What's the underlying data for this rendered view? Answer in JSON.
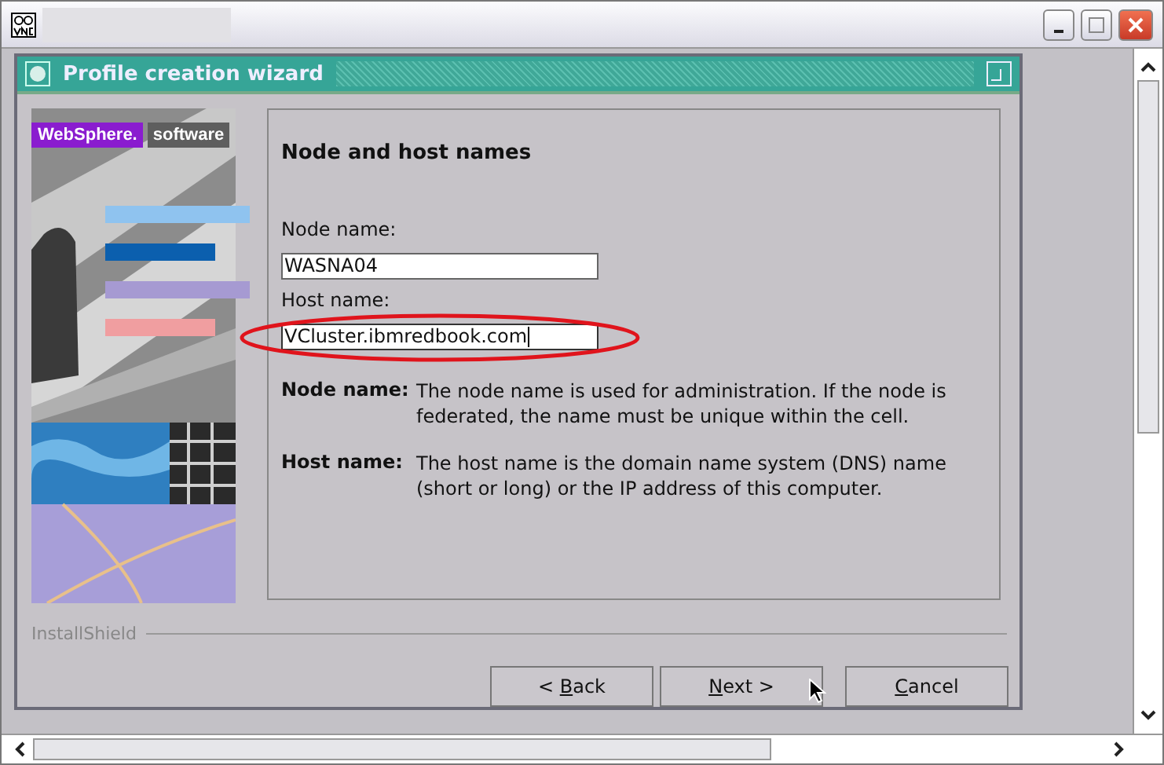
{
  "wizard": {
    "title": "Profile creation wizard",
    "brand": {
      "name": "WebSphere.",
      "product": "software"
    },
    "heading": "Node and host names",
    "fields": [
      {
        "label": "Node name:",
        "value": "WASNA04",
        "focused": false
      },
      {
        "label": "Host name:",
        "value": "VCluster.ibmredbook.com",
        "focused": true,
        "circled": true
      }
    ],
    "help": [
      {
        "term": "Node name:",
        "text": "The node name is used for administration. If the node is federated, the name must be unique within the cell."
      },
      {
        "term": "Host name:",
        "text": "The host name is the domain name system (DNS) name (short or long) or the IP address of this computer."
      }
    ],
    "footer_label": "InstallShield",
    "buttons": [
      {
        "before": "< ",
        "mnemonic": "B",
        "after": "ack",
        "kind": "back"
      },
      {
        "mnemonic": "N",
        "after": "ext >",
        "kind": "next"
      },
      {
        "mnemonic": "C",
        "after": "ancel",
        "kind": "cancel"
      }
    ]
  }
}
